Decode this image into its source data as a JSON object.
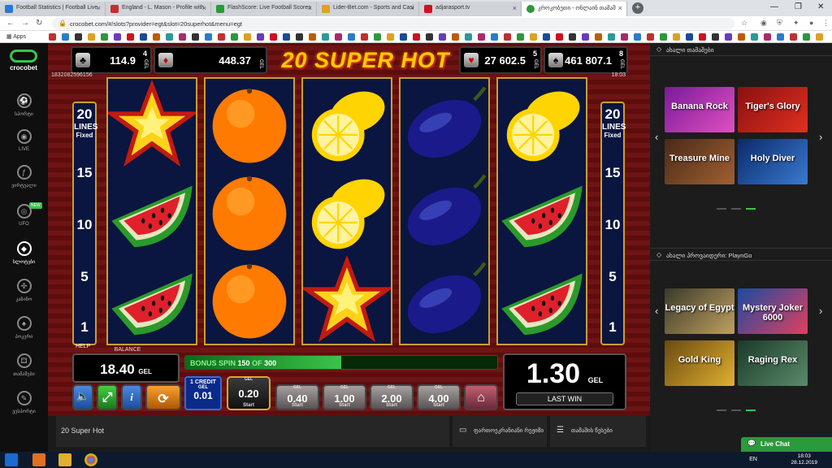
{
  "browser": {
    "tabs": [
      {
        "title": "Football Statistics | Football Live"
      },
      {
        "title": "England - L. Mason - Profile with"
      },
      {
        "title": "FlashScore: Live Football Scores"
      },
      {
        "title": "Lider-Bet.com - Sports and Casi"
      },
      {
        "title": "adjarasport.tv"
      },
      {
        "title": "კროკობეთი - ონლაინ თამაშ"
      }
    ],
    "url": "crocobet.com/#/slots?provider=egt&slot=20superhot&menu=egt",
    "apps_label": "Apps"
  },
  "sidebar": {
    "logo": "crocobet",
    "items": [
      {
        "label": "სპორტი",
        "icon": "soccer-ball-icon"
      },
      {
        "label": "LIVE",
        "icon": "live-icon"
      },
      {
        "label": "ვირტუალი",
        "icon": "virtual-icon"
      },
      {
        "label": "UFO",
        "icon": "ufo-icon",
        "badge": "NEW"
      },
      {
        "label": "სლოტები",
        "icon": "diamond-icon"
      },
      {
        "label": "კაზინო",
        "icon": "casino-chip-icon"
      },
      {
        "label": "პოკერი",
        "icon": "spade-icon"
      },
      {
        "label": "თამაშები",
        "icon": "dice-icon"
      },
      {
        "label": "ვესპორტი",
        "icon": "gamepad-icon"
      }
    ]
  },
  "game": {
    "title": "20 SUPER HOT",
    "id_text": "1832082596156",
    "time_text": "18:03",
    "jackpots": [
      {
        "suit": "♣",
        "value": "114.9",
        "sup": "4",
        "unit": "GEL"
      },
      {
        "suit": "♦",
        "value": "448.37",
        "sup": "",
        "unit": "GEL"
      },
      {
        "suit": "♥",
        "value": "27 602.5",
        "sup": "5",
        "unit": "GEL"
      },
      {
        "suit": "♠",
        "value": "461 807.1",
        "sup": "8",
        "unit": "GEL"
      }
    ],
    "lines_panel": {
      "count": "20",
      "label": "LINES",
      "sub": "Fixed",
      "marks": [
        "15",
        "10",
        "5",
        "1"
      ]
    },
    "reels": [
      [
        "star",
        "watermelon",
        "watermelon"
      ],
      [
        "orange",
        "orange",
        "orange"
      ],
      [
        "lemon",
        "lemon",
        "star"
      ],
      [
        "plum",
        "plum",
        "plum"
      ],
      [
        "lemon",
        "watermelon",
        "watermelon"
      ]
    ],
    "help": "HELP",
    "balance": {
      "label": "BALANCE",
      "value": "18.40",
      "unit": "GEL"
    },
    "bonus": {
      "label": "BONUS SPIN",
      "current": "150",
      "of": "OF",
      "total": "300",
      "progress": 0.5
    },
    "last_win": {
      "value": "1.30",
      "unit": "GEL",
      "label": "LAST WIN"
    },
    "credit": {
      "line1": "1 CREDIT",
      "line2": "GEL",
      "value": "0.01"
    },
    "bets": [
      {
        "value": "0.20",
        "tag": "GEL",
        "start": "Start",
        "selected": true
      },
      {
        "value": "0.40",
        "tag": "GEL",
        "start": "Start",
        "selected": false
      },
      {
        "value": "1.00",
        "tag": "GEL",
        "start": "Start",
        "selected": false
      },
      {
        "value": "2.00",
        "tag": "GEL",
        "start": "Start",
        "selected": false
      },
      {
        "value": "4.00",
        "tag": "GEL",
        "start": "Start",
        "selected": false
      }
    ]
  },
  "footer": {
    "game_name": "20 Super Hot",
    "fullscreen_label": "ფართოეკრანიანი რეჟიმი",
    "games_label": "თამაშის წესები"
  },
  "right_panel": {
    "section1": {
      "title": "ახალი თამაშები",
      "games": [
        "Banana Rock",
        "Tiger's Glory",
        "Treasure Mine",
        "Holy Diver"
      ]
    },
    "section2": {
      "title": "ახალი პროვაიდერი: PlaynGo",
      "games": [
        "Legacy of Egypt",
        "Mystery Joker 6000",
        "Gold King",
        "Raging Rex"
      ]
    }
  },
  "chat": {
    "label": "Live Chat"
  },
  "taskbar": {
    "lang": "EN",
    "time": "18:03",
    "date": "28.12.2019"
  }
}
